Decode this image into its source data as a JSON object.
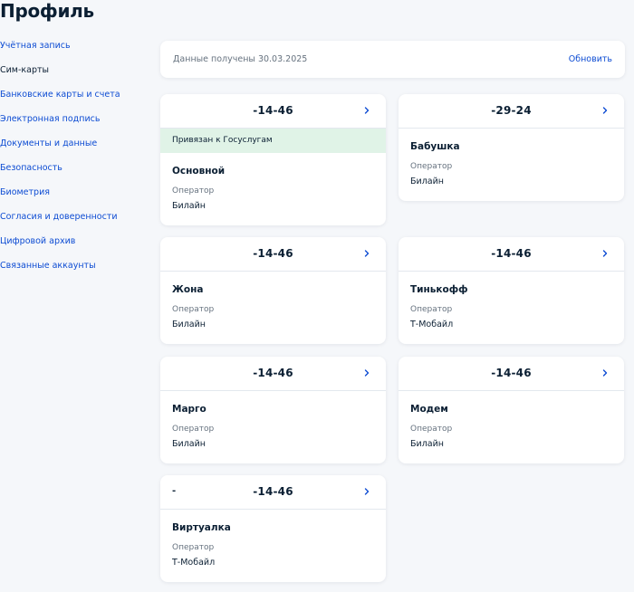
{
  "page": {
    "title": "Профиль"
  },
  "sidebar": {
    "items": [
      {
        "label": "Учётная запись",
        "active": false
      },
      {
        "label": "Сим-карты",
        "active": true
      },
      {
        "label": "Банковские карты и счета",
        "active": false
      },
      {
        "label": "Электронная подпись",
        "active": false
      },
      {
        "label": "Документы и данные",
        "active": false
      },
      {
        "label": "Безопасность",
        "active": false
      },
      {
        "label": "Биометрия",
        "active": false
      },
      {
        "label": "Согласия и доверенности",
        "active": false
      },
      {
        "label": "Цифровой архив",
        "active": false
      },
      {
        "label": "Связанные аккаунты",
        "active": false
      }
    ]
  },
  "info": {
    "text": "Данные получены 30.03.2025",
    "refresh_label": "Обновить"
  },
  "sims": [
    {
      "number": "-14-46",
      "prefix": "",
      "bound": "Привязан к Госуслугам",
      "name": "Основной",
      "operator_label": "Оператор",
      "operator": "Билайн"
    },
    {
      "number": "-29-24",
      "prefix": "",
      "bound": "",
      "name": "Бабушка",
      "operator_label": "Оператор",
      "operator": "Билайн"
    },
    {
      "number": "-14-46",
      "prefix": "",
      "bound": "",
      "name": "Жона",
      "operator_label": "Оператор",
      "operator": "Билайн"
    },
    {
      "number": "-14-46",
      "prefix": "",
      "bound": "",
      "name": "Тинькофф",
      "operator_label": "Оператор",
      "operator": "Т-Мобайл"
    },
    {
      "number": "-14-46",
      "prefix": "",
      "bound": "",
      "name": "Марго",
      "operator_label": "Оператор",
      "operator": "Билайн"
    },
    {
      "number": "-14-46",
      "prefix": "",
      "bound": "",
      "name": "Модем",
      "operator_label": "Оператор",
      "operator": "Билайн"
    },
    {
      "number": "-14-46",
      "prefix": "-",
      "bound": "",
      "name": "Виртуалка",
      "operator_label": "Оператор",
      "operator": "Т-Мобайл"
    }
  ],
  "icons": {
    "chevron": "chevron-right-icon"
  },
  "colors": {
    "link": "#0d4cd3",
    "bound_bg": "#e0f3e7",
    "page_bg": "#f5f7fa"
  }
}
